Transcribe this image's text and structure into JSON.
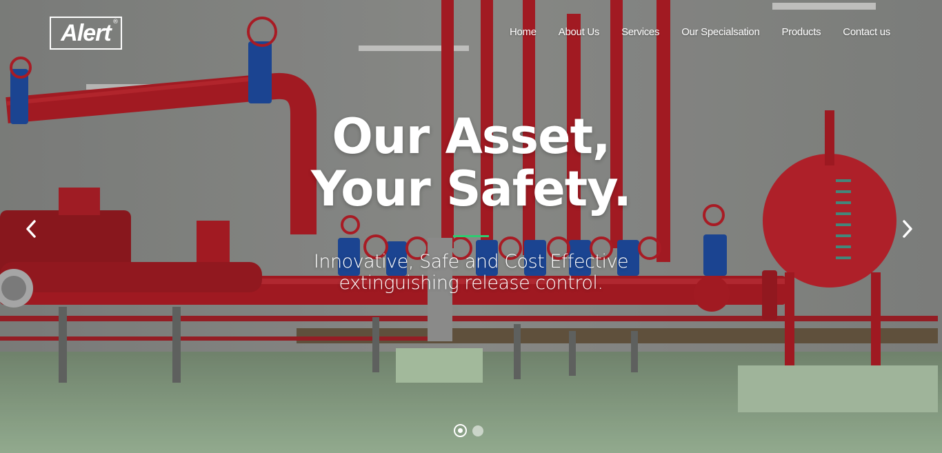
{
  "brand": {
    "logo_text": "Alert",
    "registered_mark": "®"
  },
  "nav": {
    "items": [
      {
        "label": "Home"
      },
      {
        "label": "About Us"
      },
      {
        "label": "Services"
      },
      {
        "label": "Our Specialsation"
      },
      {
        "label": "Products"
      },
      {
        "label": "Contact us"
      }
    ]
  },
  "hero": {
    "headline_line1": "Our Asset,",
    "headline_line2": "Your Safety.",
    "subline_line1": "Innovative, Safe and Cost Effective",
    "subline_line2": "extinguishing release control.",
    "background_scene": "fire-pump-room-red-pipes"
  },
  "carousel": {
    "prev_icon": "chevron-left-icon",
    "next_icon": "chevron-right-icon",
    "slide_count": 2,
    "active_slide": 1
  },
  "colors": {
    "accent": "#2ecc71",
    "pipe_red": "#c8202a",
    "valve_blue": "#1f4fa8",
    "floor_green": "#9fbf98",
    "text": "#ffffff"
  }
}
